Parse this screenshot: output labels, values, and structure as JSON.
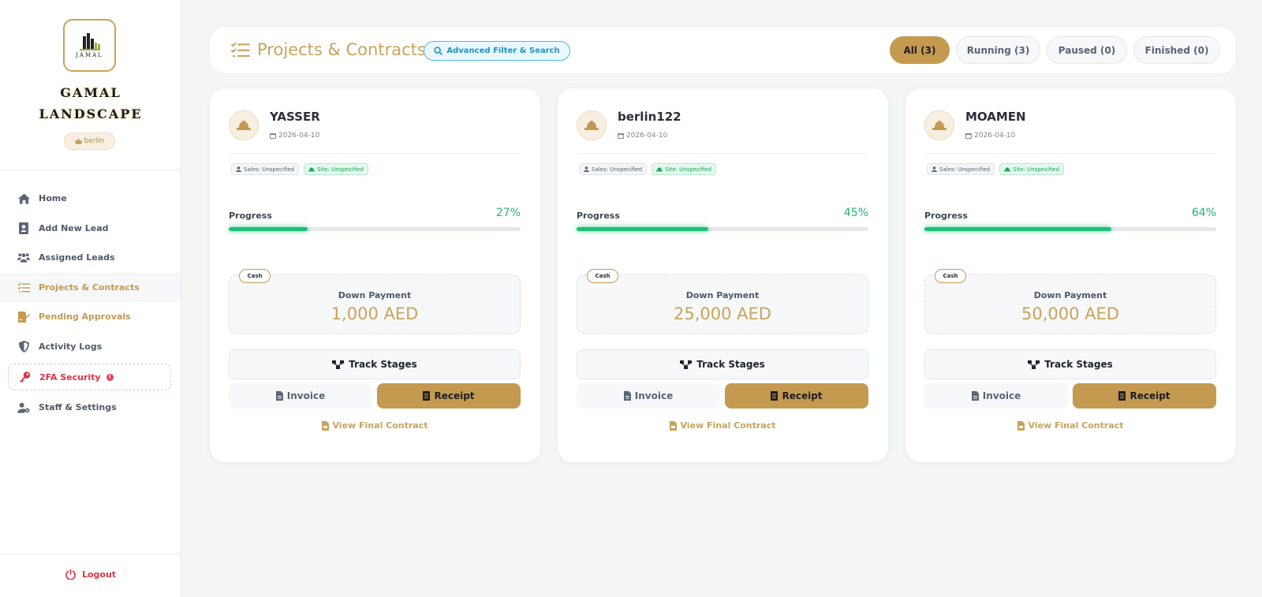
{
  "brand": {
    "logo_text": "JAMAL",
    "name_line1": "GAMAL",
    "name_line2": "LANDSCAPE",
    "user": "berlin",
    "user_icon": "crown-icon"
  },
  "sidebar": {
    "items": [
      {
        "label": "Home",
        "icon": "home-icon"
      },
      {
        "label": "Add New Lead",
        "icon": "contact-card-icon"
      },
      {
        "label": "Assigned Leads",
        "icon": "users-icon"
      },
      {
        "label": "Projects & Contracts",
        "icon": "tasks-list-icon",
        "active": true
      },
      {
        "label": "Pending Approvals",
        "icon": "signature-icon"
      },
      {
        "label": "Activity Logs",
        "icon": "shield-icon"
      },
      {
        "label": "2FA Security",
        "icon": "key-icon"
      },
      {
        "label": "Staff & Settings",
        "icon": "user-gear-icon"
      }
    ],
    "logout_label": "Logout"
  },
  "header": {
    "title": "Projects & Contracts",
    "filter_label": "Advanced Filter & Search",
    "tabs": [
      {
        "label": "All (3)",
        "active": true
      },
      {
        "label": "Running (3)"
      },
      {
        "label": "Paused (0)"
      },
      {
        "label": "Finished (0)"
      }
    ]
  },
  "labels": {
    "progress": "Progress",
    "down_payment": "Down Payment",
    "track": "Track Stages",
    "invoice": "Invoice",
    "receipt": "Receipt",
    "view_contract": "View Final Contract"
  },
  "projects": [
    {
      "name": "YASSER",
      "date": "2026-04-10",
      "sales": "Sales: Unspecified",
      "site": "Site: Unspecified",
      "progress": 27,
      "progress_text": "27%",
      "payment_type": "Cash",
      "down_payment": "1,000 AED"
    },
    {
      "name": "berlin122",
      "date": "2026-04-10",
      "sales": "Sales: Unspecified",
      "site": "Site: Unspecified",
      "progress": 45,
      "progress_text": "45%",
      "payment_type": "Cash",
      "down_payment": "25,000 AED"
    },
    {
      "name": "MOAMEN",
      "date": "2026-04-10",
      "sales": "Sales: Unspecified",
      "site": "Site: Unspecified",
      "progress": 64,
      "progress_text": "64%",
      "payment_type": "Cash",
      "down_payment": "50,000 AED"
    }
  ],
  "colors": {
    "gold": "#c39a50",
    "progress": "#1fbf7a",
    "danger": "#dc3545",
    "info": "#1a94c4"
  }
}
